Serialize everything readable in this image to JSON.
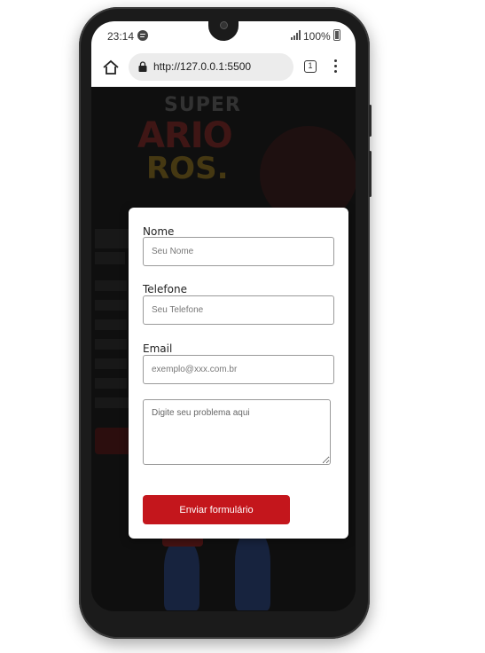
{
  "status_bar": {
    "time": "23:14",
    "battery": "100%",
    "icons": [
      "spotify-icon",
      "signal-icon",
      "battery-icon"
    ]
  },
  "browser": {
    "url": "http://127.0.0.1:5500",
    "tab_count": "1",
    "icons": [
      "home-icon",
      "lock-icon",
      "tabs-icon",
      "menu-icon"
    ]
  },
  "form": {
    "name_label": "Nome",
    "name_placeholder": "Seu Nome",
    "phone_label": "Telefone",
    "phone_placeholder": "Seu Telefone",
    "email_label": "Email",
    "email_placeholder": "exemplo@xxx.com.br",
    "message_placeholder": "Digite seu problema aqui",
    "submit_label": "Enviar formulário"
  },
  "colors": {
    "accent": "#c4161c",
    "phone_frame": "#1b1b1b",
    "page_background": "#151515"
  }
}
